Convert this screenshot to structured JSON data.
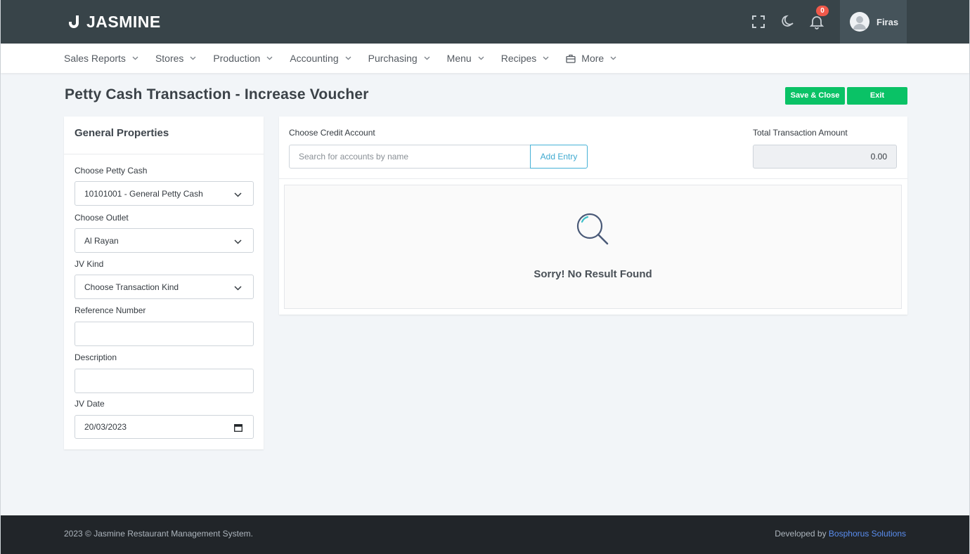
{
  "header": {
    "brand": "JASMINE",
    "notification_count": "0",
    "user_name": "Firas",
    "icons": [
      "fullscreen-icon",
      "moon-icon",
      "bell-icon",
      "user-icon"
    ]
  },
  "nav": {
    "items": [
      {
        "label": "Sales Reports"
      },
      {
        "label": "Stores"
      },
      {
        "label": "Production"
      },
      {
        "label": "Accounting"
      },
      {
        "label": "Purchasing"
      },
      {
        "label": "Menu"
      },
      {
        "label": "Recipes"
      },
      {
        "label": "More",
        "icon": "briefcase-icon"
      }
    ]
  },
  "page": {
    "title": "Petty Cash Transaction - Increase Voucher",
    "save_close_label": "Save & Close",
    "exit_label": "Exit"
  },
  "general": {
    "title": "General Properties",
    "petty_cash_label": "Choose Petty Cash",
    "petty_cash_value": "10101001 - General Petty Cash",
    "outlet_label": "Choose Outlet",
    "outlet_value": "Al Rayan",
    "jv_kind_label": "JV Kind",
    "jv_kind_value": "Choose Transaction Kind",
    "reference_label": "Reference Number",
    "reference_value": "",
    "description_label": "Description",
    "description_value": "",
    "jv_date_label": "JV Date",
    "jv_date_value": "20/03/2023"
  },
  "entries": {
    "credit_label": "Choose Credit Account",
    "search_placeholder": "Search for accounts by name",
    "add_entry_label": "Add Entry",
    "total_label": "Total Transaction Amount",
    "total_value": "0.00",
    "empty_message": "Sorry! No Result Found"
  },
  "footer": {
    "copyright": "2023 © Jasmine Restaurant Management System.",
    "developed_by": "Developed by",
    "developer": "Bosphorus Solutions"
  },
  "colors": {
    "header_bg": "#384449",
    "accent_green": "#0ac266",
    "info_blue": "#45b1d6",
    "badge_red": "#f0594a",
    "footer_bg": "#212529"
  }
}
